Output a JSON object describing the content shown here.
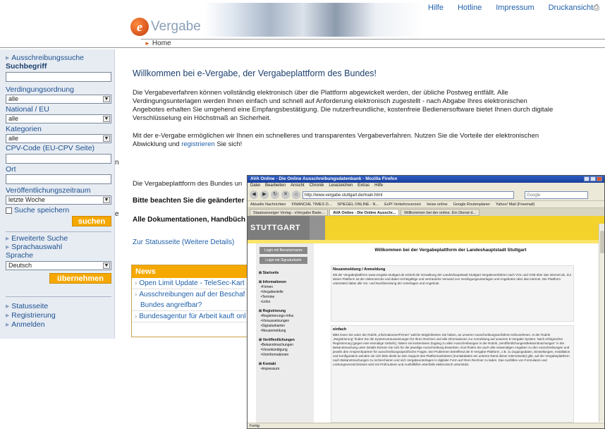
{
  "top_links": [
    "Hilfe",
    "Hotline",
    "Impressum",
    "Druckansicht"
  ],
  "logo": {
    "letter": "e",
    "text": "Vergabe"
  },
  "breadcrumb": {
    "home": "Home"
  },
  "sidebar": {
    "section1": "Ausschreibungssuche",
    "suchbegriff": "Suchbegriff",
    "verdingung_label": "Verdingungsordnung",
    "verdingung_value": "alle",
    "national_label": "National / EU",
    "national_value": "alle",
    "kategorien_label": "Kategorien",
    "kategorien_value": "alle",
    "cpv_label": "CPV-Code (EU-CPV Seite)",
    "ort_label": "Ort",
    "zeitraum_label": "Veröffentlichungszeitraum",
    "zeitraum_value": "letzte Woche",
    "suche_speichern": "Suche speichern",
    "suchen_button": "suchen",
    "erweiterte_suche": "Erweiterte Suche",
    "sprachauswahl": "Sprachauswahl",
    "sprache_label": "Sprache",
    "sprache_value": "Deutsch",
    "uebernehmen_button": "übernehmen",
    "statusseite": "Statusseite",
    "registrierung": "Registrierung",
    "anmelden": "Anmelden"
  },
  "main": {
    "welcome": "Willkommen bei e-Vergabe, der Vergabeplattform des Bundes!",
    "para1": "Die Vergabeverfahren können vollständig elektronisch über die Plattform abgewickelt werden, der übliche Postweg entfällt. Alle Verdingungsunterlagen werden Ihnen einfach und schnell auf Anforderung elektronisch zugestellt - nach Abgabe Ihres elektronischen Angebotes erhalten Sie umgehend eine Empfangsbestätigung. Die nutzerfreundliche, kostenfreie Bedienersoftware bietet Ihnen durch digitale Verschlüsselung ein Höchstmaß an Sicherheit.",
    "para2_pre": "Mit der e-Vergabe ermöglichen wir Ihnen ein schnelleres und transparentes Vergabeverfahren. Nutzen Sie die Vorteile der elektronischen Abwicklung und",
    "para2_link": "registrieren",
    "para2_post": "Sie sich!",
    "para3": "Die Vergabeplattform des Bundes un",
    "bold1": "Bitte beachten Sie die geänderter",
    "bold2": "Alle Dokumentationen, Handbüch",
    "statuslink": "Zur Statusseite (Weitere Details)",
    "stray1": "n",
    "stray2": "e"
  },
  "news": {
    "header": "News",
    "items": [
      "Open Limit Update - TeleSec-Kart",
      "Ausschreibungen auf der Beschaf",
      "Bundes angreifbar?",
      "Bundesagentur für Arbeit kauft onl"
    ]
  },
  "firefox": {
    "title": "AVA Online - Die Online Ausschreibungsdatenbank - Mozilla Firefox",
    "menu": [
      "Datei",
      "Bearbeiten",
      "Ansicht",
      "Chronik",
      "Lesezeichen",
      "Extras",
      "Hilfe"
    ],
    "url": "http://www.vergabe.stuttgart.de/main.html",
    "search_placeholder": "Google",
    "bookmarks": [
      "Aktuelle Nachrichten",
      "FINANCIAL TIMES D...",
      "SPIEGEL ONLINE - N...",
      "ExPI Verkehrsverzeic",
      "heise online",
      "Google Routenplaner",
      "Yahoo! Mail (Freemail)"
    ],
    "tabs": [
      "Staatsanzeiger Verlag - eVergabe Bade...",
      "AVA Online - Die Online Ausschr...",
      "Willkommen bei der online. Ein Dienst d..."
    ],
    "status": "Fertig"
  },
  "stuttgart": {
    "logo": "STUTTGART",
    "btn1": "Login mit Benutzername",
    "btn2": "Login mit Signaturkarte",
    "nav": [
      {
        "t": "Startseite",
        "h": true
      },
      {
        "t": "Informationen",
        "h": true
      },
      {
        "t": "Firmen",
        "h": false
      },
      {
        "t": "Vergabestelle",
        "h": false
      },
      {
        "t": "Termine",
        "h": false
      },
      {
        "t": "Links",
        "h": false
      },
      {
        "t": "Registrierung",
        "h": true
      },
      {
        "t": "Registrierungs-Infos",
        "h": false
      },
      {
        "t": "Voraussetzungen",
        "h": false
      },
      {
        "t": "Signaturkarten",
        "h": false
      },
      {
        "t": "Neuanmeldung",
        "h": false
      },
      {
        "t": "Veröffentlichungen",
        "h": true
      },
      {
        "t": "Bekanntmachungen",
        "h": false
      },
      {
        "t": "Vorankündigung",
        "h": false
      },
      {
        "t": "Vorinformationen",
        "h": false
      },
      {
        "t": "Kontakt",
        "h": true
      },
      {
        "t": "Impressum",
        "h": false
      }
    ],
    "title": "Willkommen bei der Vergabeplattform der Landeshauptstadt Stuttgart",
    "box1_head": "Neuanmeldung / Anmeldung",
    "box1_text": "Mit der Vergabeplattform www.vergabe.stuttgart.de wickelt die Verwaltung der Landeshauptstadt Stuttgart Vergabeverfahren nach VOL und VOB über das Internet ab. Zur dieser Plattform ist der elektronische und dabei rechtsgültige und vertrauliche Versand von Verdingungsunterlagen und Angeboten über das Internet. Die Plattform unterstützt dabei alle Vor- und Nachbereitung der Unterlagen und Angebote.",
    "box2_head": "einfach",
    "box2_text": "Bitte lesen Sie unter der Rubrik „Informationen/Firmen“ welche Möglichkeiten Sie haben, an unseren Ausschreibungsverfahren teilzunehmen. In der Rubrik „Registrierung“ finden Sie die Systemvoraussetzungen für Ihren Rechner und alle Informationen zur Anmeldung auf unserem E-Vergabe System. Nach erfolgreicher Registrierung (gegen eine einmalige Gebühr), haben sie kostenlosen Zugang zu allen Ausschreibungen in der Rubrik „Veröffentlichungen/Bekanntmachungen“ in der Bekanntmachung unter Details können Sie sich für die jeweilige Ausschreibung bewerben. Dort finden Sie auch alle notwendigen Angaben zu den Ausschreibungen und jeweils den Ansprechpartner für ausschreibungsspezifische Fragen. Bei Problemen betreffend der E-Vergabe Plattform, z.B. zu Zugangsdaten, Einstellungen, Installation und Konfiguration wenden sie sich bitte direkt an den Support des Plattformanbieters (Kontaktdaten am unteren Rand dieser Internetseite) gibt, auf der Vergabeplattform nach Bekanntmachungen zu recherchieren und sich Vergabeunterlagen in digitaler Form auf Ihren Rechner zu laden. Das Ausfüllen von Formularen und Leistungsverzeichnissen wird mit Prüfroutinen und Ausfüllhilfen ebenfalls elektronisch unterstützt."
  }
}
